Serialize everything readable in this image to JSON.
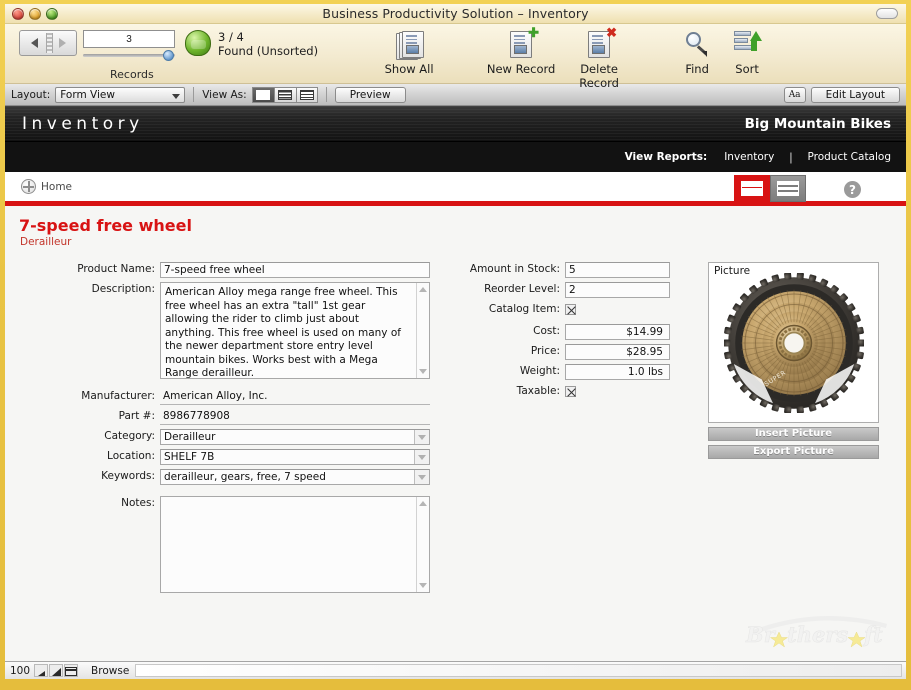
{
  "window": {
    "title": "Business Productivity Solution – Inventory",
    "traffic_lights": [
      "close-red",
      "minimize-yellow",
      "zoom-green"
    ],
    "toolbar_pill": "toolbar-toggle"
  },
  "toolbar": {
    "record_number": "3",
    "found_count": "3 / 4",
    "found_status": "Found (Unsorted)",
    "records_label": "Records",
    "items": [
      {
        "label": "Show All",
        "icon": "show-all-icon"
      },
      {
        "label": "New Record",
        "icon": "new-record-icon"
      },
      {
        "label": "Delete Record",
        "icon": "delete-record-icon"
      },
      {
        "label": "Find",
        "icon": "find-icon"
      },
      {
        "label": "Sort",
        "icon": "sort-icon"
      }
    ]
  },
  "layout_bar": {
    "layout_label": "Layout:",
    "layout_value": "Form View",
    "view_as_label": "View As:",
    "view_as_options": [
      "form-view",
      "list-view",
      "table-view"
    ],
    "view_as_selected": "form-view",
    "preview_label": "Preview",
    "text_format_label": "Aa",
    "edit_layout_label": "Edit Layout"
  },
  "banner": {
    "title": "Inventory",
    "brand": "Big Mountain Bikes",
    "view_reports_label": "View Reports:",
    "report_links": [
      "Inventory",
      "Product Catalog"
    ],
    "separator": "|"
  },
  "navstrip": {
    "home_label": "Home",
    "home_icon": "home-globe-icon",
    "view_form_icon": "form-view-icon",
    "view_list_icon": "list-view-icon",
    "help_icon": "help-icon",
    "accent_color": "#d81313"
  },
  "record": {
    "title": "7-speed free wheel",
    "subtitle": "Derailleur",
    "fields_left": [
      {
        "label": "Product Name:",
        "value": "7-speed free wheel",
        "type": "text"
      },
      {
        "label": "Description:",
        "value": "American Alloy mega range free wheel. This free wheel has an extra \"tall\" 1st gear allowing the rider to climb just about anything. This free wheel is used on many of the newer department store entry level mountain bikes. Works best with a Mega Range derailleur.",
        "type": "textarea"
      },
      {
        "label": "Manufacturer:",
        "value": "American Alloy, Inc.",
        "type": "text"
      },
      {
        "label": "Part #:",
        "value": "8986778908",
        "type": "text"
      },
      {
        "label": "Category:",
        "value": "Derailleur",
        "type": "dropdown"
      },
      {
        "label": "Location:",
        "value": "SHELF 7B",
        "type": "dropdown"
      },
      {
        "label": "Keywords:",
        "value": "derailleur, gears, free, 7 speed",
        "type": "dropdown"
      },
      {
        "label": "Notes:",
        "value": "",
        "type": "textarea"
      }
    ],
    "fields_mid": [
      {
        "label": "Amount in Stock:",
        "value": "5",
        "type": "text"
      },
      {
        "label": "Reorder Level:",
        "value": "2",
        "type": "text"
      },
      {
        "label": "Catalog Item:",
        "value": "checked",
        "type": "checkbox"
      },
      {
        "label": "Cost:",
        "value": "$14.99",
        "type": "number"
      },
      {
        "label": "Price:",
        "value": "$28.95",
        "type": "number"
      },
      {
        "label": "Weight:",
        "value": "1.0 lbs",
        "type": "number"
      },
      {
        "label": "Taxable:",
        "value": "checked",
        "type": "checkbox"
      }
    ],
    "picture": {
      "label": "Picture",
      "alt": "bicycle-freewheel-cassette",
      "insert_label": "Insert Picture",
      "export_label": "Export Picture"
    }
  },
  "watermark": {
    "text": "Brothersoft"
  },
  "statusbar": {
    "zoom": "100",
    "zoom_out_icon": "zoom-out-icon",
    "zoom_in_icon": "zoom-in-icon",
    "status_toggle_icon": "status-area-icon",
    "mode": "Browse"
  }
}
